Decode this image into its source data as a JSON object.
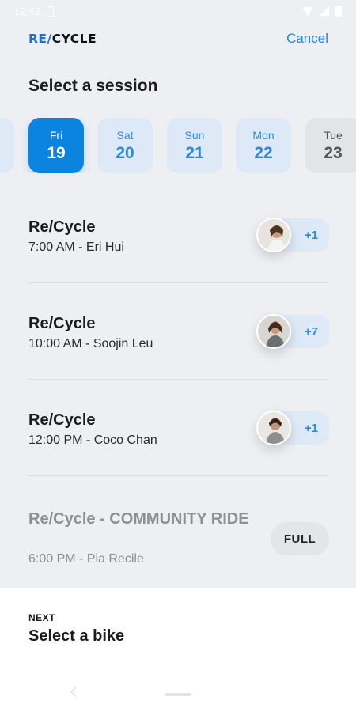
{
  "status": {
    "time": "12:42"
  },
  "header": {
    "logo_prefix": "RE/",
    "logo_suffix": "CYCLE",
    "cancel_label": "Cancel"
  },
  "page": {
    "title": "Select a session"
  },
  "dates": [
    {
      "dow": "Fri",
      "num": "19",
      "state": "selected"
    },
    {
      "dow": "Sat",
      "num": "20",
      "state": "available"
    },
    {
      "dow": "Sun",
      "num": "21",
      "state": "available"
    },
    {
      "dow": "Mon",
      "num": "22",
      "state": "available"
    },
    {
      "dow": "Tue",
      "num": "23",
      "state": "unavailable"
    }
  ],
  "sessions": [
    {
      "title": "Re/Cycle",
      "subtitle": "7:00 AM - Eri Hui",
      "count": "+1"
    },
    {
      "title": "Re/Cycle",
      "subtitle": "10:00 AM - Soojin Leu",
      "count": "+7"
    },
    {
      "title": "Re/Cycle",
      "subtitle": "12:00 PM - Coco Chan",
      "count": "+1"
    },
    {
      "title": "Re/Cycle - COMMUNITY RIDE",
      "subtitle": "6:00 PM - Pia Recile",
      "status": "FULL"
    }
  ],
  "next": {
    "label": "NEXT",
    "title": "Select a bike"
  },
  "colors": {
    "accent": "#0b84e0",
    "accent_soft": "#dde9f6",
    "background": "#eeeff3"
  }
}
